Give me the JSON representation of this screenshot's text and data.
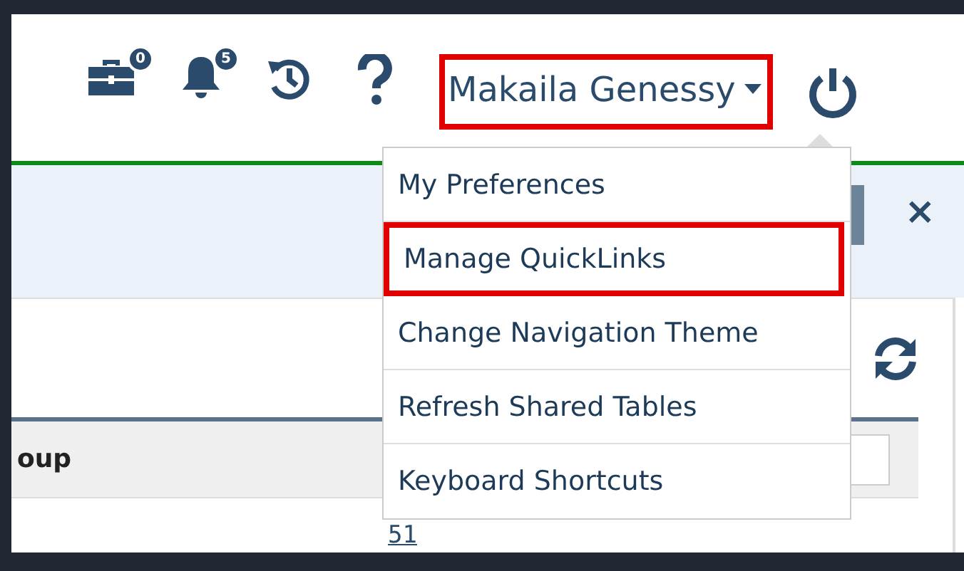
{
  "header": {
    "icons": [
      {
        "kind": "briefcase",
        "badge": "0"
      },
      {
        "kind": "bell",
        "badge": "5"
      },
      {
        "kind": "history"
      },
      {
        "kind": "help"
      }
    ],
    "user_menu": {
      "label": "Makaila Genessy",
      "highlighted": true,
      "expanded": true
    }
  },
  "panel": {
    "close_label": "×"
  },
  "user_menu_items": [
    {
      "label": "My Preferences",
      "highlighted": false
    },
    {
      "label": "Manage QuickLinks",
      "highlighted": true
    },
    {
      "label": "Change Navigation Theme",
      "highlighted": false
    },
    {
      "label": "Refresh Shared Tables",
      "highlighted": false
    },
    {
      "label": "Keyboard Shortcuts",
      "highlighted": false
    }
  ],
  "table": {
    "columns": [
      "oup"
    ],
    "rows": [
      [
        "51"
      ]
    ]
  }
}
